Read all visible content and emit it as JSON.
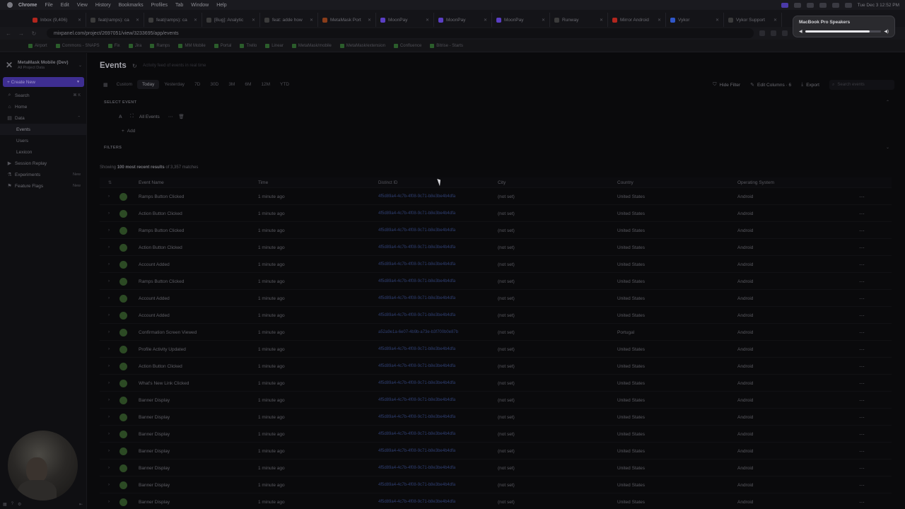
{
  "menubar": {
    "app": "Chrome",
    "items": [
      "File",
      "Edit",
      "View",
      "History",
      "Bookmarks",
      "Profiles",
      "Tab",
      "Window",
      "Help"
    ],
    "clock": "Tue Dec 3  12:52 PM"
  },
  "tabs": [
    {
      "label": "Inbox (9,406)",
      "color": "#b3261e"
    },
    {
      "label": "feat(ramps): ca",
      "color": "#3b3b3b"
    },
    {
      "label": "feat(ramps): ca",
      "color": "#3b3b3b"
    },
    {
      "label": "[Bug]: Analytic",
      "color": "#3b3b3b"
    },
    {
      "label": "feat: adde how",
      "color": "#3b3b3b"
    },
    {
      "label": "MetaMask Port",
      "color": "#8a3d1a"
    },
    {
      "label": "MoonPay",
      "color": "#5b3fc4"
    },
    {
      "label": "MoonPay",
      "color": "#5b3fc4"
    },
    {
      "label": "MoonPay",
      "color": "#5b3fc4"
    },
    {
      "label": "Runway",
      "color": "#3b3b3b"
    },
    {
      "label": "Mirror Android",
      "color": "#b3261e"
    },
    {
      "label": "Vykor",
      "color": "#3057c9"
    },
    {
      "label": "Vykor Support",
      "color": "#3b3b3b"
    }
  ],
  "address": {
    "url": "mixpanel.com/project/2697051/view/3233695/app/events"
  },
  "bookmarks": [
    "Airport",
    "Commons - SNAPS",
    "Fix",
    "Jira",
    "Ramps",
    "MM Mobile",
    "Portal",
    "Trello",
    "Linear",
    "MetaMask/mobile",
    "MetaMask/extension",
    "Confluence",
    "Bitrise - Starts"
  ],
  "speaker_popup": {
    "title": "MacBook Pro Speakers",
    "volume": 0.85
  },
  "sidebar": {
    "project_name": "MetaMask Mobile (Dev)",
    "project_sub": "All Project Data",
    "create_label": "+ Create New",
    "items": [
      {
        "label": "Search",
        "icon": "⌕",
        "extra": "⌘ K"
      },
      {
        "label": "Home",
        "icon": "⌂",
        "extra": ""
      },
      {
        "label": "Data",
        "icon": "▤",
        "extra": "⌃"
      },
      {
        "label": "Events",
        "icon": "",
        "extra": ""
      },
      {
        "label": "Users",
        "icon": "",
        "extra": ""
      },
      {
        "label": "Lexicon",
        "icon": "",
        "extra": ""
      },
      {
        "label": "Session Replay",
        "icon": "▶",
        "extra": ""
      },
      {
        "label": "Experiments",
        "icon": "⚗",
        "extra": "New"
      },
      {
        "label": "Feature Flags",
        "icon": "⚑",
        "extra": "New"
      }
    ]
  },
  "main": {
    "title": "Events",
    "subtitle": "Activity feed of events in real time",
    "ranges": [
      "Custom",
      "Today",
      "Yesterday",
      "7D",
      "30D",
      "3M",
      "6M",
      "12M",
      "YTD"
    ],
    "selected_range": "Today",
    "hide_filter": "Hide Filter",
    "edit_columns": "Edit Columns · 6",
    "export": "Export",
    "search_placeholder": "Search events",
    "select_event": "SELECT EVENT",
    "event_letter": "A",
    "all_events": "All Events",
    "add": "Add",
    "filters": "FILTERS",
    "results_prefix": "Showing ",
    "results_bold": "100 most recent results",
    "results_suffix": " of 3,357 matches"
  },
  "table": {
    "columns": [
      "Event Name",
      "Time",
      "Distinct ID",
      "City",
      "Country",
      "Operating System"
    ],
    "rows": [
      {
        "event": "Ramps Button Clicked",
        "time": "1 minute ago",
        "did": "4f5d89a4-4c7b-4f08-9c71-b8e3be4b4dfa",
        "city": "(not set)",
        "country": "United States",
        "os": "Android"
      },
      {
        "event": "Action Button Clicked",
        "time": "1 minute ago",
        "did": "4f5d89a4-4c7b-4f08-9c71-b8e3be4b4dfa",
        "city": "(not set)",
        "country": "United States",
        "os": "Android"
      },
      {
        "event": "Ramps Button Clicked",
        "time": "1 minute ago",
        "did": "4f5d89a4-4c7b-4f08-9c71-b8e3be4b4dfa",
        "city": "(not set)",
        "country": "United States",
        "os": "Android"
      },
      {
        "event": "Action Button Clicked",
        "time": "1 minute ago",
        "did": "4f5d89a4-4c7b-4f08-9c71-b8e3be4b4dfa",
        "city": "(not set)",
        "country": "United States",
        "os": "Android"
      },
      {
        "event": "Account Added",
        "time": "1 minute ago",
        "did": "4f5d89a4-4c7b-4f08-9c71-b8e3be4b4dfa",
        "city": "(not set)",
        "country": "United States",
        "os": "Android"
      },
      {
        "event": "Ramps Button Clicked",
        "time": "1 minute ago",
        "did": "4f5d89a4-4c7b-4f08-9c71-b8e3be4b4dfa",
        "city": "(not set)",
        "country": "United States",
        "os": "Android"
      },
      {
        "event": "Account Added",
        "time": "1 minute ago",
        "did": "4f5d89a4-4c7b-4f08-9c71-b8e3be4b4dfa",
        "city": "(not set)",
        "country": "United States",
        "os": "Android"
      },
      {
        "event": "Account Added",
        "time": "1 minute ago",
        "did": "4f5d89a4-4c7b-4f08-9c71-b8e3be4b4dfa",
        "city": "(not set)",
        "country": "United States",
        "os": "Android"
      },
      {
        "event": "Confirmation Screen Viewed",
        "time": "1 minute ago",
        "did": "a52a9e1a-6e07-4b9b-a73e-b3f700b0e87b",
        "city": "(not set)",
        "country": "Portugal",
        "os": "Android"
      },
      {
        "event": "Profile Activity Updated",
        "time": "1 minute ago",
        "did": "4f5d89a4-4c7b-4f08-9c71-b8e3be4b4dfa",
        "city": "(not set)",
        "country": "United States",
        "os": "Android"
      },
      {
        "event": "Action Button Clicked",
        "time": "1 minute ago",
        "did": "4f5d89a4-4c7b-4f08-9c71-b8e3be4b4dfa",
        "city": "(not set)",
        "country": "United States",
        "os": "Android"
      },
      {
        "event": "What's New Link Clicked",
        "time": "1 minute ago",
        "did": "4f5d89a4-4c7b-4f08-9c71-b8e3be4b4dfa",
        "city": "(not set)",
        "country": "United States",
        "os": "Android"
      },
      {
        "event": "Banner Display",
        "time": "1 minute ago",
        "did": "4f5d89a4-4c7b-4f08-9c71-b8e3be4b4dfa",
        "city": "(not set)",
        "country": "United States",
        "os": "Android"
      },
      {
        "event": "Banner Display",
        "time": "1 minute ago",
        "did": "4f5d89a4-4c7b-4f08-9c71-b8e3be4b4dfa",
        "city": "(not set)",
        "country": "United States",
        "os": "Android"
      },
      {
        "event": "Banner Display",
        "time": "1 minute ago",
        "did": "4f5d89a4-4c7b-4f08-9c71-b8e3be4b4dfa",
        "city": "(not set)",
        "country": "United States",
        "os": "Android"
      },
      {
        "event": "Banner Display",
        "time": "1 minute ago",
        "did": "4f5d89a4-4c7b-4f08-9c71-b8e3be4b4dfa",
        "city": "(not set)",
        "country": "United States",
        "os": "Android"
      },
      {
        "event": "Banner Display",
        "time": "1 minute ago",
        "did": "4f5d89a4-4c7b-4f08-9c71-b8e3be4b4dfa",
        "city": "(not set)",
        "country": "United States",
        "os": "Android"
      },
      {
        "event": "Banner Display",
        "time": "1 minute ago",
        "did": "4f5d89a4-4c7b-4f08-9c71-b8e3be4b4dfa",
        "city": "(not set)",
        "country": "United States",
        "os": "Android"
      },
      {
        "event": "Banner Display",
        "time": "1 minute ago",
        "did": "4f5d89a4-4c7b-4f08-9c71-b8e3be4b4dfa",
        "city": "(not set)",
        "country": "United States",
        "os": "Android"
      }
    ]
  }
}
